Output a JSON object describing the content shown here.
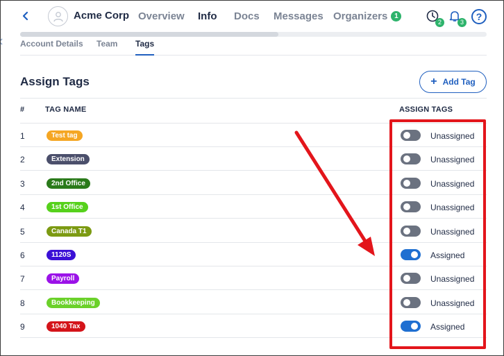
{
  "header": {
    "company_name": "Acme Corp",
    "tabs": [
      {
        "label": "Overview"
      },
      {
        "label": "Info"
      },
      {
        "label": "Docs"
      },
      {
        "label": "Messages"
      },
      {
        "label": "Organizers",
        "badge": "1"
      }
    ],
    "active_tab": "Info",
    "icons": [
      {
        "name": "clock-icon",
        "badge": "2"
      },
      {
        "name": "bell-icon",
        "badge": "3"
      },
      {
        "name": "help-icon",
        "glyph": "?"
      }
    ]
  },
  "subtabs": [
    {
      "label": "Account Details"
    },
    {
      "label": "Team"
    },
    {
      "label": "Tags"
    }
  ],
  "active_subtab": "Tags",
  "section": {
    "title": "Assign Tags",
    "add_button_label": "Add Tag"
  },
  "table": {
    "columns": [
      "#",
      "TAG NAME",
      "ASSIGN TAGS"
    ],
    "rows": [
      {
        "num": "1",
        "tag": "Test tag",
        "color": "#f5a623",
        "assigned": false,
        "status": "Unassigned"
      },
      {
        "num": "2",
        "tag": "Extension",
        "color": "#4b4f6b",
        "assigned": false,
        "status": "Unassigned"
      },
      {
        "num": "3",
        "tag": "2nd Office",
        "color": "#2a7a1a",
        "assigned": false,
        "status": "Unassigned"
      },
      {
        "num": "4",
        "tag": "1st Office",
        "color": "#56d11c",
        "assigned": false,
        "status": "Unassigned"
      },
      {
        "num": "5",
        "tag": "Canada T1",
        "color": "#7c9a12",
        "assigned": false,
        "status": "Unassigned"
      },
      {
        "num": "6",
        "tag": "1120S",
        "color": "#3b10d6",
        "assigned": true,
        "status": "Assigned"
      },
      {
        "num": "7",
        "tag": "Payroll",
        "color": "#9b12e8",
        "assigned": false,
        "status": "Unassigned"
      },
      {
        "num": "8",
        "tag": "Bookkeeping",
        "color": "#6bd12a",
        "assigned": false,
        "status": "Unassigned"
      },
      {
        "num": "9",
        "tag": "1040 Tax",
        "color": "#d4141a",
        "assigned": true,
        "status": "Assigned"
      }
    ]
  },
  "colors": {
    "accent": "#1f5fbf",
    "badge_green": "#2db36b",
    "annotation_red": "#e3151b",
    "toggle_off": "#6b7280",
    "toggle_on": "#1f6fd1"
  }
}
